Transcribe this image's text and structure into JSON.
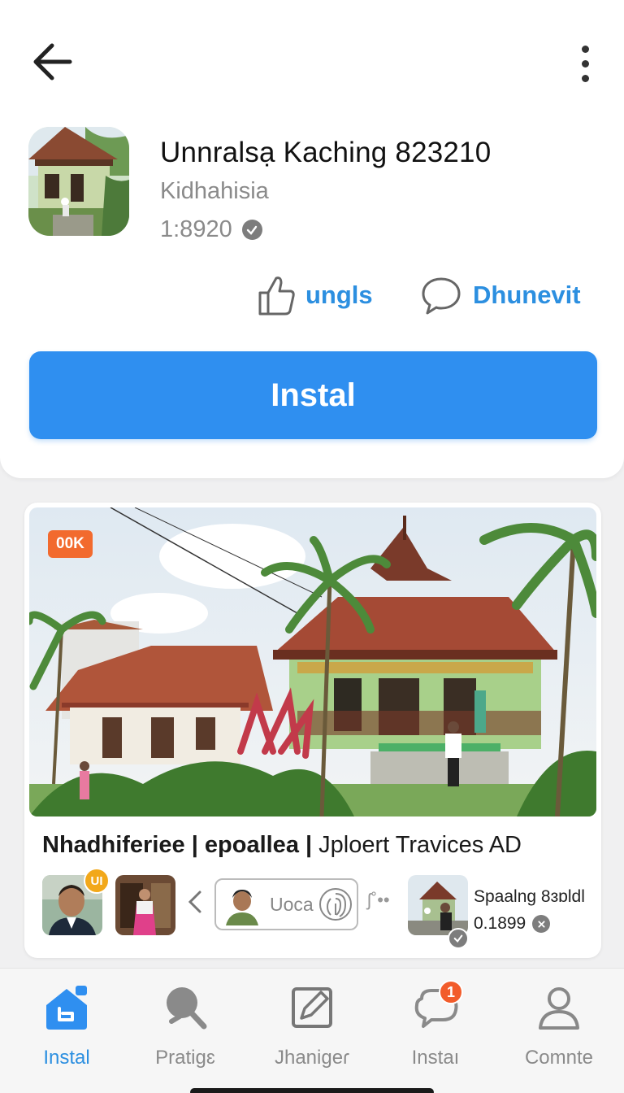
{
  "header": {
    "back_icon": "arrow-left-icon",
    "more_icon": "more-vertical-icon"
  },
  "app": {
    "title": "Unnralsạ Kaching 823210",
    "developer": "Kidhahisia",
    "meta": "1:8920",
    "verified_icon": "verified-check-icon"
  },
  "actions": {
    "like_label": "ungls",
    "comment_label": "Dhunevit"
  },
  "install_button": "Instal",
  "feature": {
    "badge": "00K",
    "title_bold": "Nhadhiferiee | epoallea |",
    "title_rest": " Jploert Travices AD",
    "avatar_badge": "UI",
    "pill_label": "Uoca",
    "dots_text": "ʃ˚••",
    "side_title": "Spaalng 8ɜɒldl",
    "side_meta": "0.1899"
  },
  "nav": {
    "items": [
      {
        "label": "Instal",
        "icon": "home-store-icon",
        "active": true
      },
      {
        "label": "Pratigɛ",
        "icon": "search-icon"
      },
      {
        "label": "Jhanigeɾ",
        "icon": "edit-icon"
      },
      {
        "label": "Instaı",
        "icon": "chat-bubble-icon",
        "badge": "1"
      },
      {
        "label": "Comnte",
        "icon": "profile-icon"
      }
    ]
  },
  "colors": {
    "accent": "#2f8ff0",
    "link": "#2c8fe0",
    "badge_orange": "#f26a2e"
  }
}
